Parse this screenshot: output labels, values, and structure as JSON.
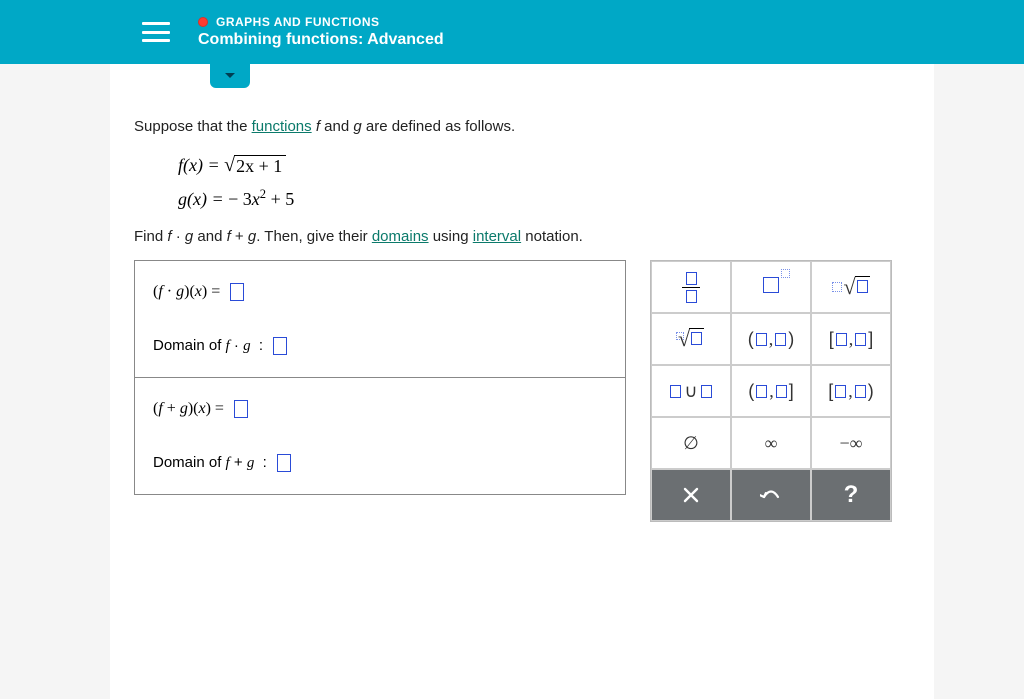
{
  "header": {
    "category": "GRAPHS AND FUNCTIONS",
    "title": "Combining functions: Advanced"
  },
  "intro": {
    "pre": "Suppose that the ",
    "link_functions": "functions",
    "post": " f and g are defined as follows."
  },
  "definitions": {
    "f_lhs": "f(x)",
    "f_radicand": "2x + 1",
    "g_lhs": "g(x)",
    "g_rhs": "− 3x",
    "g_exp": "2",
    "g_tail": " + 5"
  },
  "task": {
    "pre": "Find f · g and f + g. Then, give their ",
    "link_domains": "domains",
    "mid": " using ",
    "link_interval": "interval",
    "post": " notation."
  },
  "answers": {
    "fg_label": "(f · g)(x) = ",
    "domain_fg_label": "Domain of f · g  : ",
    "fplusg_label": "(f + g)(x) = ",
    "domain_fplusg_label": "Domain of f + g  : "
  },
  "palette": {
    "empty": "∅",
    "inf": "∞",
    "neginf": "−∞",
    "times": "×",
    "help": "?",
    "union": "∪"
  }
}
